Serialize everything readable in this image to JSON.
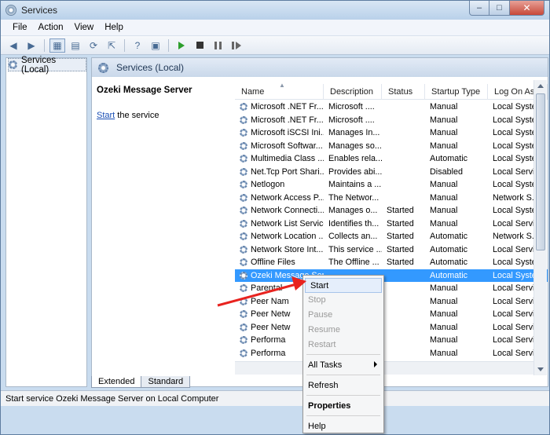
{
  "window": {
    "title": "Services"
  },
  "menu": [
    "File",
    "Action",
    "View",
    "Help"
  ],
  "tree": {
    "root_label": "Services (Local)"
  },
  "pane": {
    "header": "Services (Local)",
    "service_title": "Ozeki Message Server",
    "action_link": "Start",
    "action_suffix": " the service"
  },
  "columns": [
    "Name",
    "Description",
    "Status",
    "Startup Type",
    "Log On As"
  ],
  "rows": [
    {
      "name": "Microsoft .NET Fr...",
      "desc": "Microsoft ....",
      "status": "",
      "startup": "Manual",
      "logon": "Local Syste"
    },
    {
      "name": "Microsoft .NET Fr...",
      "desc": "Microsoft ....",
      "status": "",
      "startup": "Manual",
      "logon": "Local Syste"
    },
    {
      "name": "Microsoft iSCSI Ini...",
      "desc": "Manages In...",
      "status": "",
      "startup": "Manual",
      "logon": "Local Syste"
    },
    {
      "name": "Microsoft Softwar...",
      "desc": "Manages so...",
      "status": "",
      "startup": "Manual",
      "logon": "Local Syste"
    },
    {
      "name": "Multimedia Class ...",
      "desc": "Enables rela...",
      "status": "",
      "startup": "Automatic",
      "logon": "Local Syste"
    },
    {
      "name": "Net.Tcp Port Shari...",
      "desc": "Provides abi...",
      "status": "",
      "startup": "Disabled",
      "logon": "Local Servi"
    },
    {
      "name": "Netlogon",
      "desc": "Maintains a ...",
      "status": "",
      "startup": "Manual",
      "logon": "Local Syste"
    },
    {
      "name": "Network Access P...",
      "desc": "The Networ...",
      "status": "",
      "startup": "Manual",
      "logon": "Network S..."
    },
    {
      "name": "Network Connecti...",
      "desc": "Manages o...",
      "status": "Started",
      "startup": "Manual",
      "logon": "Local Syste"
    },
    {
      "name": "Network List Service",
      "desc": "Identifies th...",
      "status": "Started",
      "startup": "Manual",
      "logon": "Local Servi"
    },
    {
      "name": "Network Location ...",
      "desc": "Collects an...",
      "status": "Started",
      "startup": "Automatic",
      "logon": "Network S..."
    },
    {
      "name": "Network Store Int...",
      "desc": "This service ...",
      "status": "Started",
      "startup": "Automatic",
      "logon": "Local Servi"
    },
    {
      "name": "Offline Files",
      "desc": "The Offline ...",
      "status": "Started",
      "startup": "Automatic",
      "logon": "Local Syste"
    },
    {
      "name": "Ozeki Message Ser...",
      "desc": "",
      "status": "",
      "startup": "Automatic",
      "logon": "Local Syste"
    },
    {
      "name": "Parental",
      "desc": "",
      "status": "",
      "startup": "Manual",
      "logon": "Local Servi"
    },
    {
      "name": "Peer Nam",
      "desc": "",
      "status": "",
      "startup": "Manual",
      "logon": "Local Servi"
    },
    {
      "name": "Peer Netw",
      "desc": "",
      "status": "",
      "startup": "Manual",
      "logon": "Local Servi"
    },
    {
      "name": "Peer Netw",
      "desc": "",
      "status": "",
      "startup": "Manual",
      "logon": "Local Servi"
    },
    {
      "name": "Performa",
      "desc": "",
      "status": "",
      "startup": "Manual",
      "logon": "Local Servi"
    },
    {
      "name": "Performa",
      "desc": "",
      "status": "",
      "startup": "Manual",
      "logon": "Local Servi"
    }
  ],
  "tabs": [
    "Extended",
    "Standard"
  ],
  "status_bar": "Start service Ozeki Message Server on Local Computer",
  "context_menu": {
    "start": "Start",
    "stop": "Stop",
    "pause": "Pause",
    "resume": "Resume",
    "restart": "Restart",
    "all_tasks": "All Tasks",
    "refresh": "Refresh",
    "properties": "Properties",
    "help": "Help"
  },
  "colors": {
    "selection": "#3399ff",
    "arrow": "#e8231f",
    "link": "#1a4fb5"
  }
}
